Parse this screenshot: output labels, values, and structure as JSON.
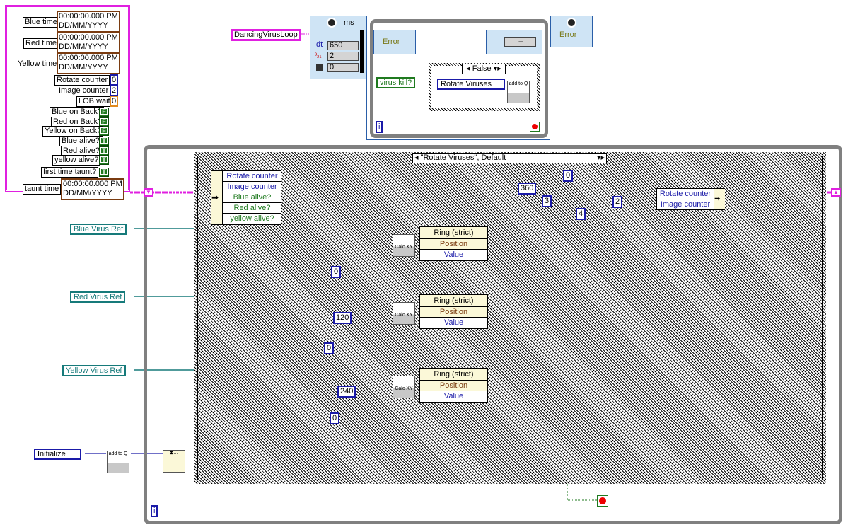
{
  "cluster": {
    "times": [
      {
        "label": "Blue time",
        "value": "00:00:00.000 PM",
        "date": "DD/MM/YYYY"
      },
      {
        "label": "Red time",
        "value": "00:00:00.000 PM",
        "date": "DD/MM/YYYY"
      },
      {
        "label": "Yellow time",
        "value": "00:00:00.000 PM",
        "date": "DD/MM/YYYY"
      }
    ],
    "numbers": [
      {
        "label": "Rotate counter",
        "value": "0"
      },
      {
        "label": "Image counter",
        "value": "2"
      },
      {
        "label": "LOB wait",
        "value": "0"
      }
    ],
    "booleans": [
      {
        "label": "Blue on Back?",
        "value": "F"
      },
      {
        "label": "Red on Back?",
        "value": "F"
      },
      {
        "label": "Yellow on Back?",
        "value": "F"
      },
      {
        "label": "Blue alive?",
        "value": "T"
      },
      {
        "label": "Red alive?",
        "value": "T"
      },
      {
        "label": "yellow alive?",
        "value": "T"
      },
      {
        "label": "first time taunt?",
        "value": "T"
      }
    ],
    "taunt": {
      "label": "taunt time",
      "value": "00:00:00.000 PM",
      "date": "DD/MM/YYYY"
    }
  },
  "timed_loop": {
    "name": "DancingVirusLoop",
    "unit": "ms",
    "dt_label": "dt",
    "dt": "650",
    "priority": "2",
    "processor": "0",
    "error_in": "Error",
    "error_out": "Error",
    "status": "--"
  },
  "inner": {
    "control": "virus kill?",
    "case": "False",
    "enum": "Rotate Viruses",
    "iter": "i"
  },
  "case": {
    "selector": "\"Rotate Viruses\", Default",
    "unbundle": [
      "Rotate counter",
      "Image counter",
      "Blue alive?",
      "Red alive?",
      "yellow alive?"
    ],
    "bundle": [
      "Rotate counter",
      "Image counter"
    ],
    "consts": {
      "c0a": "0",
      "c360": "360",
      "c3": "3",
      "c4": "4",
      "c2": "2",
      "c0b": "0",
      "c120": "120",
      "c0c": "0",
      "c240": "240",
      "c0d": "0"
    },
    "ring": {
      "title": "Ring (strict)",
      "p1": "Position",
      "p2": "Value"
    }
  },
  "refs": [
    "Blue Virus Ref",
    "Red Virus Ref",
    "Yellow Virus Ref"
  ],
  "init": "Initialize",
  "outer_iter": "i",
  "colors": {
    "cluster": "#e020e0",
    "numeric": "#1a1aa8",
    "boolean": "#1f7a1f",
    "ref": "#167a7a",
    "loop": "#808080"
  }
}
